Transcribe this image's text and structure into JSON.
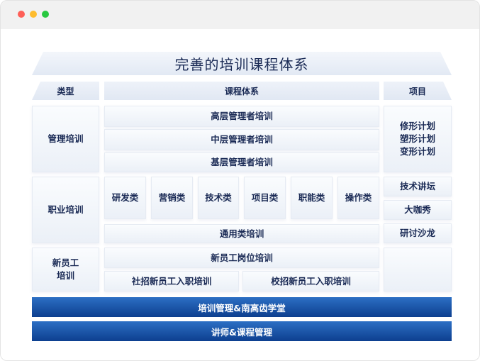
{
  "title": "完善的培训课程体系",
  "headers": {
    "type": "类型",
    "system": "课程体系",
    "project": "项目"
  },
  "types": {
    "management": "管理培训",
    "professional": "职业培训",
    "newcomer_line1": "新员工",
    "newcomer_line2": "培训"
  },
  "management_courses": [
    "高层管理者培训",
    "中层管理者培训",
    "基层管理者培训"
  ],
  "management_projects": [
    "修形计划",
    "塑形计划",
    "变形计划"
  ],
  "professional_courses": [
    "研发类",
    "营销类",
    "技术类",
    "项目类",
    "职能类",
    "操作类"
  ],
  "general_course": "通用类培训",
  "professional_projects": [
    "技术讲坛",
    "大咖秀",
    "研讨沙龙"
  ],
  "newcomer_course": "新员工岗位培训",
  "newcomer_split": [
    "社招新员工入职培训",
    "校招新员工入职培训"
  ],
  "bars": [
    "培训管理&南高齿学堂",
    "讲师&课程管理"
  ]
}
